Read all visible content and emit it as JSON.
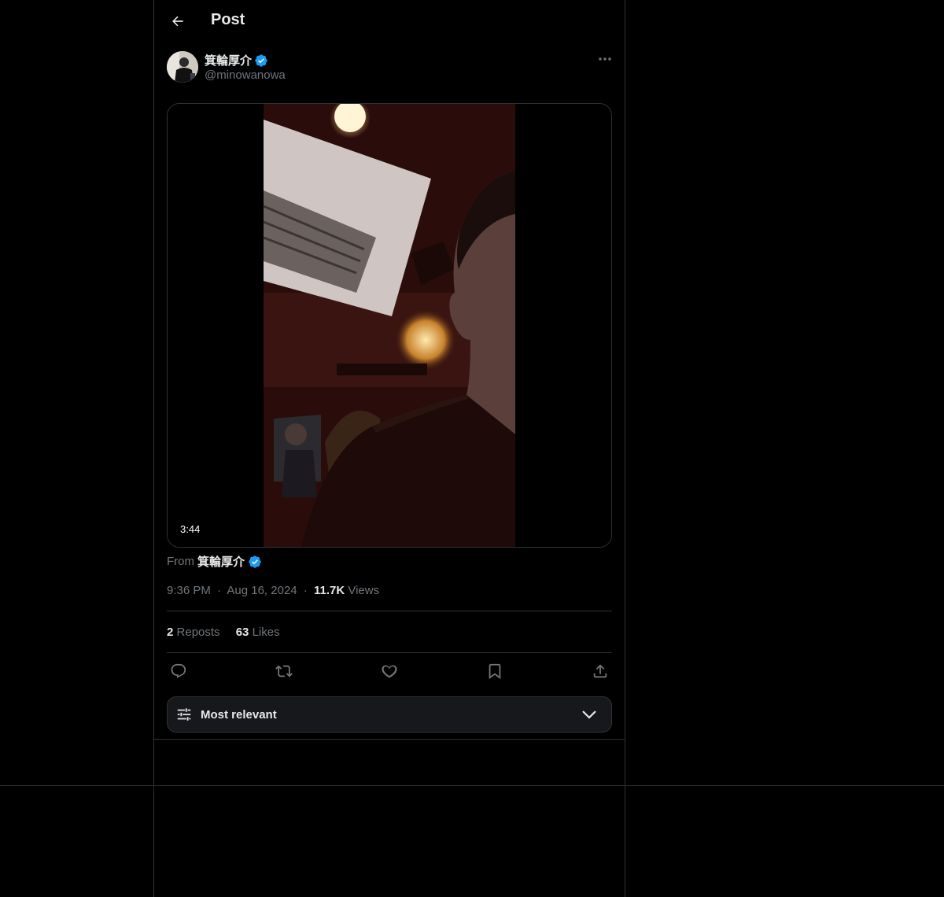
{
  "header": {
    "title": "Post"
  },
  "author": {
    "name": "箕輪厚介",
    "handle": "@minowanowa"
  },
  "media": {
    "duration": "3:44"
  },
  "from": {
    "prefix": "From",
    "name": "箕輪厚介"
  },
  "meta": {
    "time": "9:36 PM",
    "sep1": "·",
    "date": "Aug 16, 2024",
    "sep2": "·",
    "views_count": "11.7K",
    "views_label": "Views"
  },
  "stats": {
    "reposts_count": "2",
    "reposts_label": "Reposts",
    "likes_count": "63",
    "likes_label": "Likes"
  },
  "sort": {
    "label": "Most relevant"
  },
  "colors": {
    "background": "#000000",
    "text": "#e7e9ea",
    "muted": "#71767b",
    "border": "#2f3336",
    "verified": "#1d9bf0"
  },
  "icons": [
    "back-arrow-icon",
    "verified-badge-icon",
    "more-icon",
    "reply-icon",
    "repost-icon",
    "like-icon",
    "bookmark-icon",
    "share-icon",
    "tune-icon",
    "chevron-down-icon"
  ]
}
